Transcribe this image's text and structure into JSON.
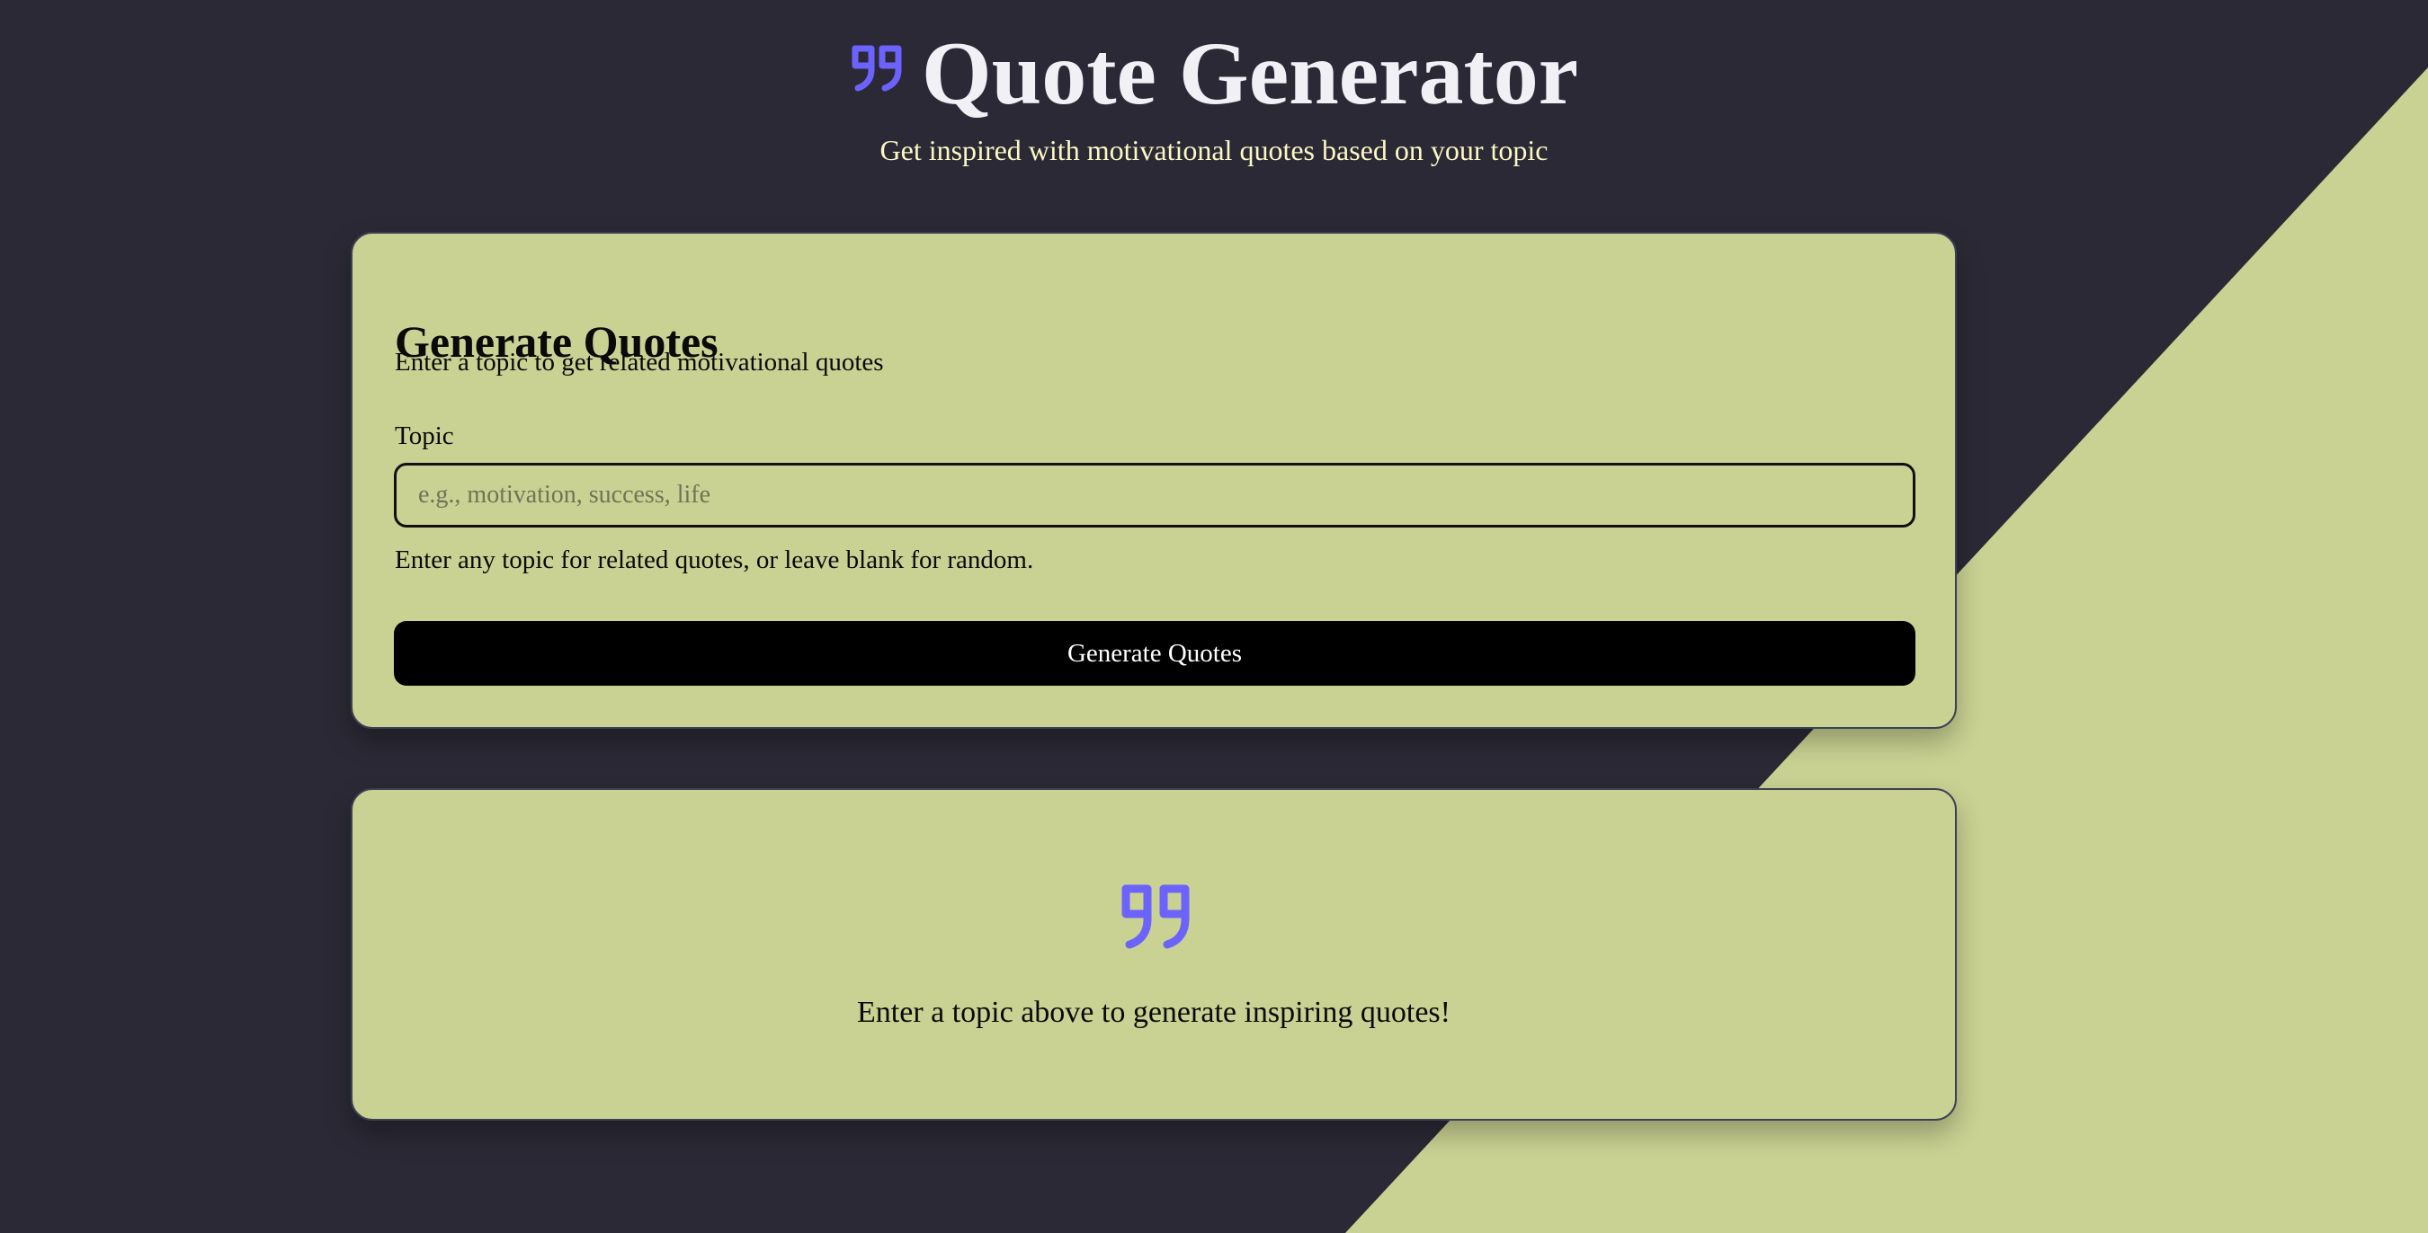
{
  "theme": {
    "background": "#2a2935",
    "accent_panel": "#c9d293",
    "icon_color": "#6c63ff",
    "title_color": "#f1f0f5",
    "subtitle_color": "#fdf7c3",
    "button_bg": "#000000",
    "button_text": "#ffffff"
  },
  "header": {
    "icon": "quote-icon",
    "title": "Quote Generator",
    "subtitle": "Get inspired with motivational quotes based on your topic"
  },
  "form_card": {
    "title": "Generate Quotes",
    "description": "Enter a topic to get related motivational quotes",
    "topic_label": "Topic",
    "topic_value": "",
    "topic_placeholder": "e.g., motivation, success, life",
    "helper_text": "Enter any topic for related quotes, or leave blank for random.",
    "button_label": "Generate Quotes"
  },
  "empty_state": {
    "icon": "quote-icon",
    "message": "Enter a topic above to generate inspiring quotes!"
  }
}
